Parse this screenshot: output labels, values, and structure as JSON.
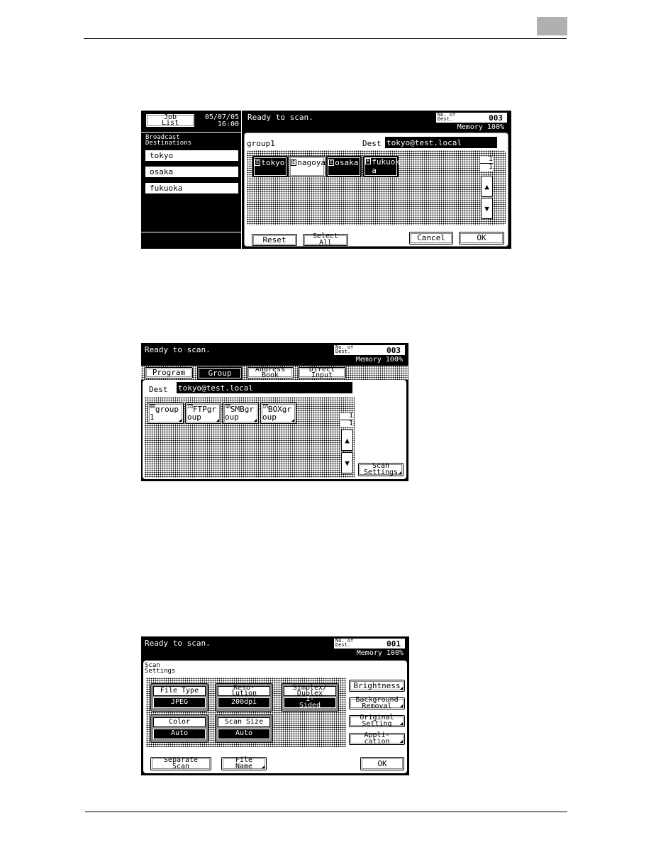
{
  "page": {
    "accent_colors": {
      "screen_bg": "#000000",
      "panel_bg": "#ffffff",
      "header_tab": "#b0b0b0"
    }
  },
  "screen1": {
    "job_list_label": "Job\nList",
    "date": "05/07/05",
    "time": "16:00",
    "status": "Ready to scan.",
    "dest_count_label": "No. of\nDest.",
    "dest_count": "003",
    "memory": "Memory 100%",
    "sidebar_title": "Broadcast\nDestinations",
    "broadcast_list": [
      {
        "label": "tokyo"
      },
      {
        "label": "osaka"
      },
      {
        "label": "fukuoka"
      }
    ],
    "group_name": "group1",
    "dest_label": "Dest",
    "dest_value": "tokyo@test.local",
    "destinations": [
      {
        "badge": "E",
        "label": "tokyo",
        "selected": true
      },
      {
        "badge": "E",
        "label": "nagoya",
        "selected": false
      },
      {
        "badge": "E",
        "label": "osaka",
        "selected": true
      },
      {
        "badge": "E",
        "label": "fukuok\na",
        "selected": true
      }
    ],
    "page_current": "1",
    "page_total": "1",
    "scroll_up_icon": "up-arrow-icon",
    "scroll_down_icon": "down-arrow-icon",
    "reset_label": "Reset",
    "select_all_label": "Select\nAll",
    "cancel_label": "Cancel",
    "ok_label": "OK"
  },
  "screen2": {
    "status": "Ready to scan.",
    "dest_count_label": "No. of\nDest.",
    "dest_count": "003",
    "memory": "Memory 100%",
    "tabs": [
      {
        "label": "Program",
        "active": false
      },
      {
        "label": "Group",
        "active": true
      },
      {
        "label": "Address\nBook",
        "active": false
      },
      {
        "label": "Direct\nInput",
        "active": false
      }
    ],
    "dest_label": "Dest",
    "dest_value": "tokyo@test.local",
    "groups": [
      {
        "icon": "001",
        "line1": "group",
        "line2": "1"
      },
      {
        "icon": "172",
        "line1": "FTPgr",
        "line2": "oup"
      },
      {
        "icon": "183",
        "line1": "SMBgr",
        "line2": "oup"
      },
      {
        "icon": "171",
        "line1": "BOXgr",
        "line2": "oup"
      }
    ],
    "page_current": "1",
    "page_total": "1",
    "scan_settings_label": "Scan\nSettings"
  },
  "screen3": {
    "status": "Ready to scan.",
    "dest_count_label": "No. of\nDest.",
    "dest_count": "001",
    "memory": "Memory 100%",
    "title": "Scan\nSettings",
    "settings": [
      {
        "label": "File Type",
        "value": "JPEG"
      },
      {
        "label": "Reso-\nlution",
        "value": "200dpi"
      },
      {
        "label": "Simplex/\nDuplex",
        "value": "1-\nSided"
      },
      {
        "label": "Color",
        "value": "Auto"
      },
      {
        "label": "Scan Size",
        "value": "Auto"
      }
    ],
    "side_buttons": [
      {
        "label": "Brightness"
      },
      {
        "label": "Background\nRemoval"
      },
      {
        "label": "Original\nSetting"
      },
      {
        "label": "Appli-\ncation"
      }
    ],
    "separate_scan_label": "Separate\nScan",
    "file_name_label": "File\nName",
    "ok_label": "OK"
  }
}
